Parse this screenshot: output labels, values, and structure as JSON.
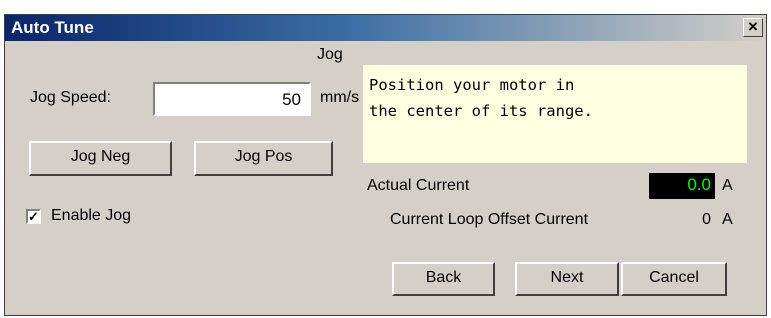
{
  "window": {
    "title": "Auto Tune",
    "close_glyph": "×"
  },
  "section": {
    "title": "Jog"
  },
  "jog_speed": {
    "label": "Jog Speed:",
    "value": "50",
    "unit": "mm/s"
  },
  "buttons": {
    "jog_neg": "Jog Neg",
    "jog_pos": "Jog Pos",
    "back": "Back",
    "next": "Next",
    "cancel": "Cancel"
  },
  "enable_jog": {
    "label": "Enable Jog",
    "checked": true,
    "check_glyph": "✓"
  },
  "message": {
    "text": "Position your motor in\nthe center of its range."
  },
  "actual_current": {
    "label": "Actual Current",
    "value": "0.0",
    "unit": "A"
  },
  "offset_current": {
    "label": "Current Loop Offset Current",
    "value": "0",
    "unit": "A"
  },
  "colors": {
    "title_start": "#0a246a",
    "title_end": "#d4d0c8",
    "message_bg": "#ffffe1",
    "display_bg": "#000000",
    "display_fg": "#00ff00"
  }
}
